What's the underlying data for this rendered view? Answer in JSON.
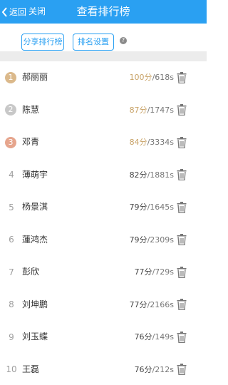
{
  "header": {
    "back_label": "返回",
    "close_label": "关闭",
    "title": "查看排行榜"
  },
  "toolbar": {
    "share_label": "分享排行榜",
    "setting_label": "排名设置",
    "help_symbol": "?"
  },
  "colors": {
    "accent": "#2aa0f2",
    "gold": "#dbb98b",
    "silver": "#c8c8c8",
    "bronze": "#e6a58d",
    "top_score": "#c8a266"
  },
  "rows": [
    {
      "rank": "1",
      "name": "郝丽丽",
      "score": "100分",
      "time": "/618s"
    },
    {
      "rank": "2",
      "name": "陈慧",
      "score": "87分",
      "time": "/1747s"
    },
    {
      "rank": "3",
      "name": "邓青",
      "score": "84分",
      "time": "/3334s"
    },
    {
      "rank": "4",
      "name": "薄萌宇",
      "score": "82分",
      "time": "/1881s"
    },
    {
      "rank": "5",
      "name": "杨景淇",
      "score": "79分",
      "time": "/1645s"
    },
    {
      "rank": "6",
      "name": "蓮鸿杰",
      "score": "79分",
      "time": "/2309s"
    },
    {
      "rank": "7",
      "name": "彭欣",
      "score": "77分",
      "time": "/729s"
    },
    {
      "rank": "8",
      "name": "刘坤鹏",
      "score": "77分",
      "time": "/2166s"
    },
    {
      "rank": "9",
      "name": "刘玉蝶",
      "score": "76分",
      "time": "/149s"
    },
    {
      "rank": "10",
      "name": "王磊",
      "score": "76分",
      "time": "/212s"
    }
  ]
}
